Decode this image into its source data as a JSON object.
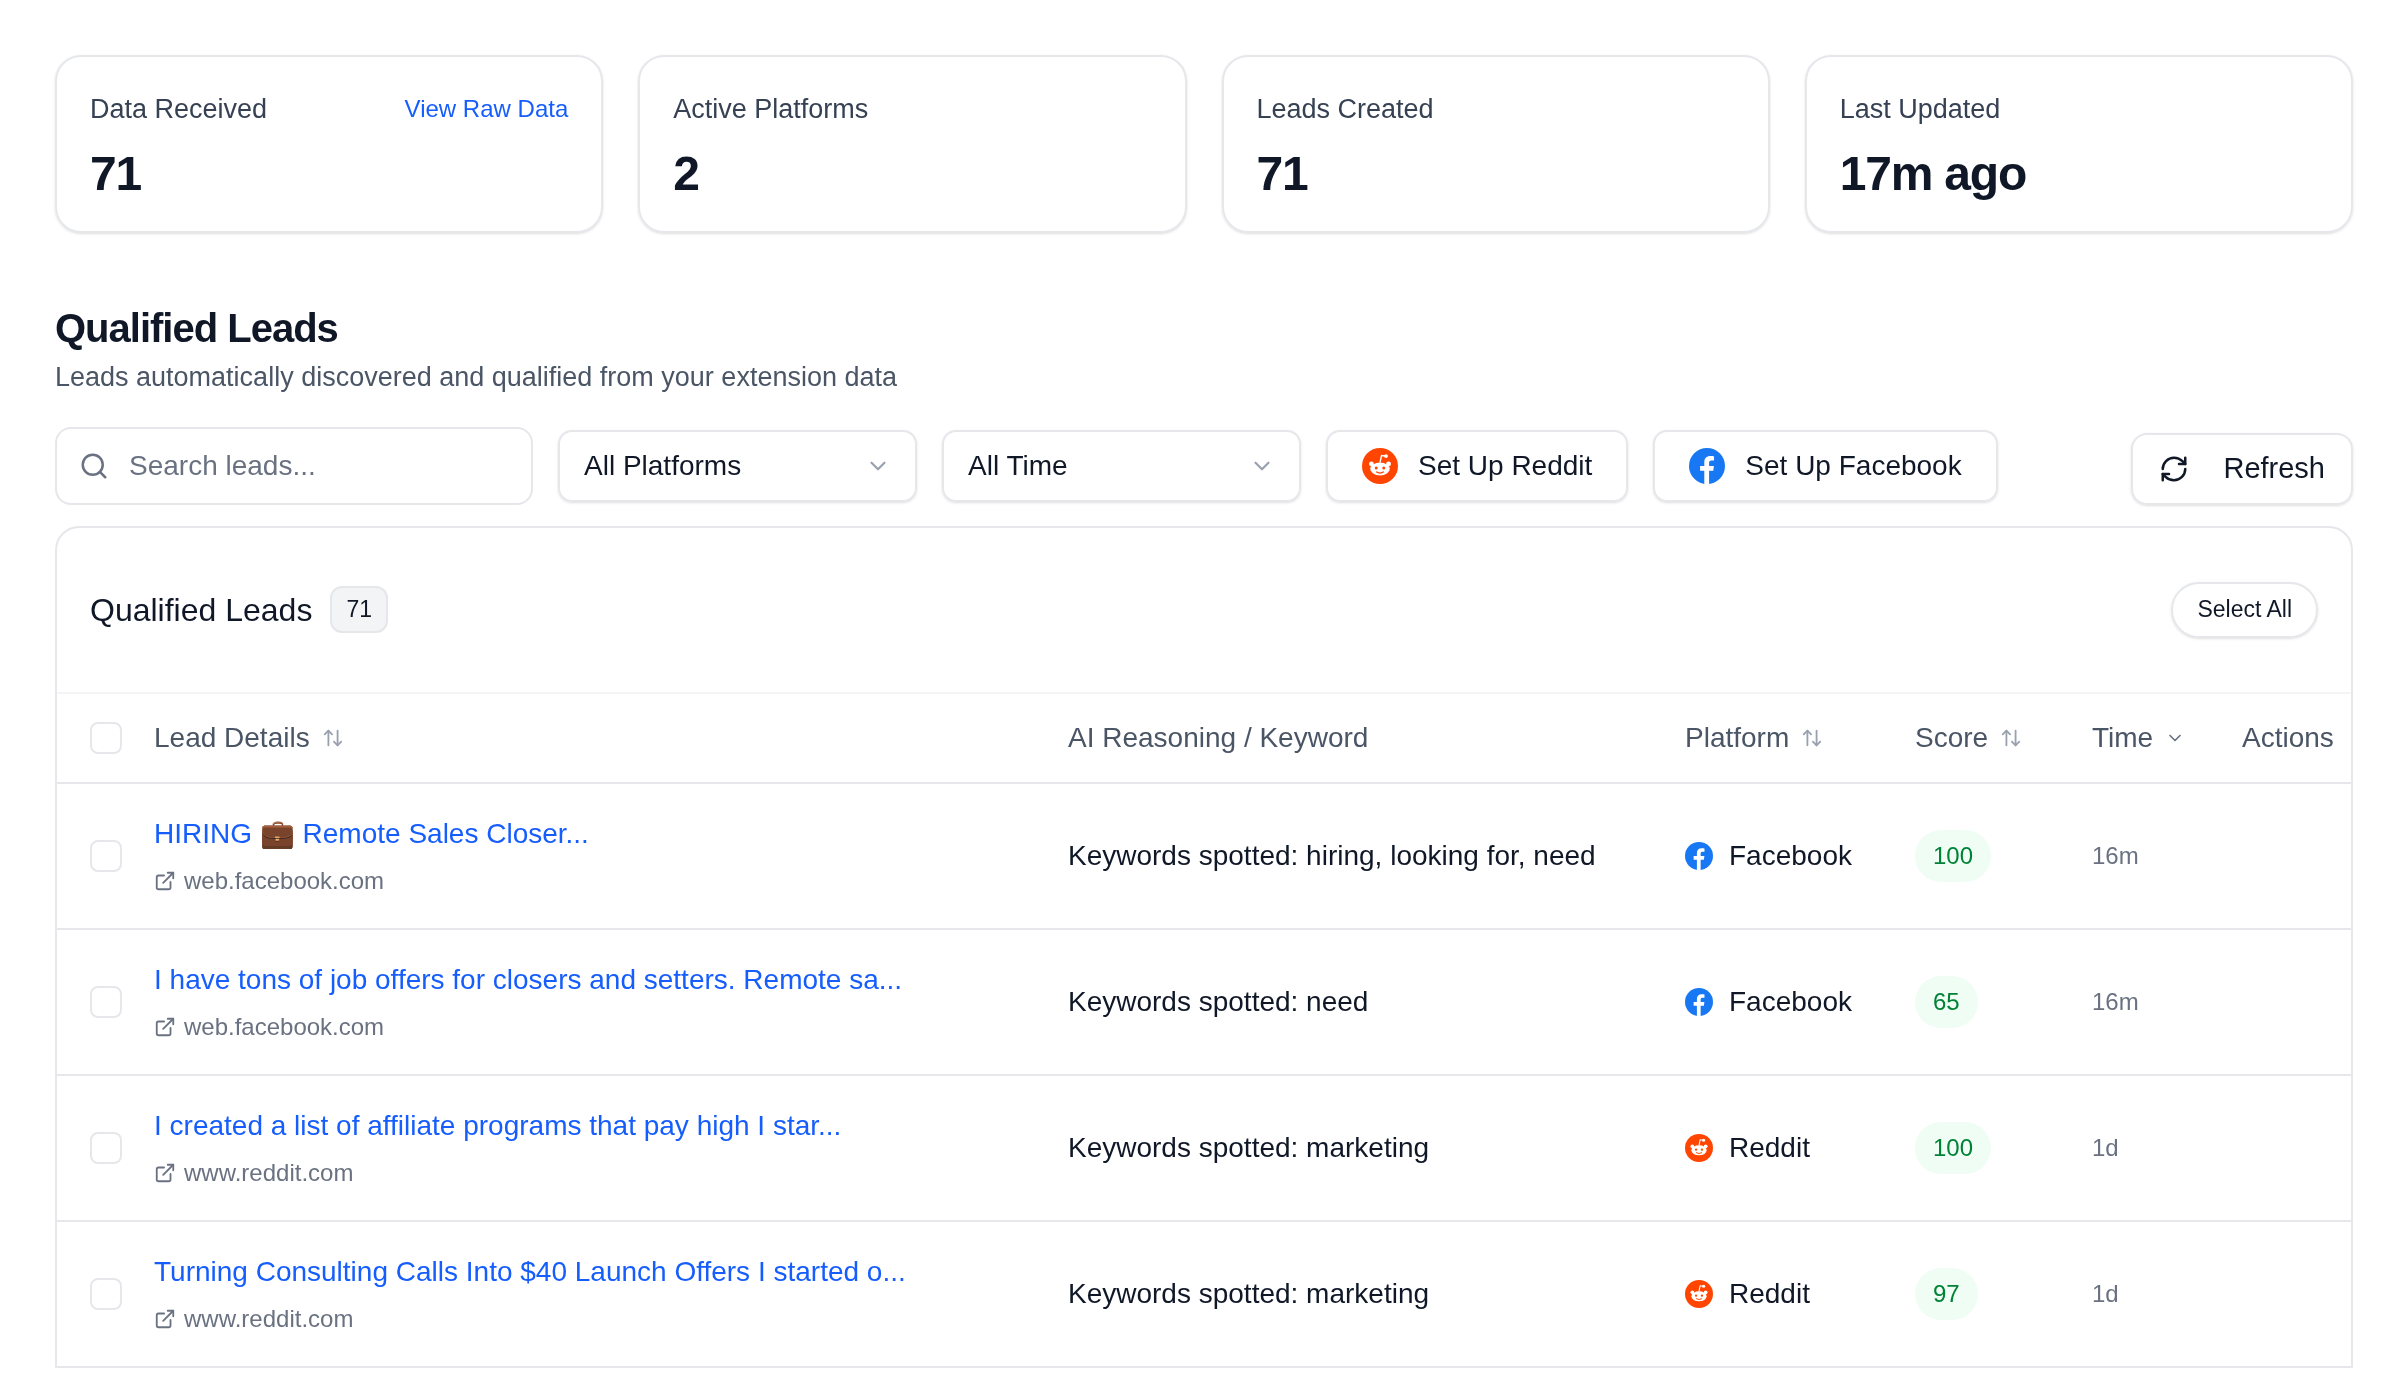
{
  "stats": [
    {
      "label": "Data Received",
      "value": "71",
      "link": "View Raw Data"
    },
    {
      "label": "Active Platforms",
      "value": "2"
    },
    {
      "label": "Leads Created",
      "value": "71"
    },
    {
      "label": "Last Updated",
      "value": "17m ago"
    }
  ],
  "section": {
    "title": "Qualified Leads",
    "subtitle": "Leads automatically discovered and qualified from your extension data"
  },
  "toolbar": {
    "search": {
      "placeholder": "Search leads..."
    },
    "platform_filter": "All Platforms",
    "time_filter": "All Time",
    "setup_buttons": [
      {
        "kind": "reddit",
        "label": "Set Up Reddit"
      },
      {
        "kind": "facebook",
        "label": "Set Up Facebook"
      }
    ],
    "refresh": "Refresh"
  },
  "table": {
    "title": "Qualified Leads",
    "count": "71",
    "select_all": "Select All",
    "all_checked": false,
    "columns": [
      {
        "label": "Lead Details",
        "kind": "sortable"
      },
      {
        "label": "AI Reasoning / Keyword",
        "kind": "plain"
      },
      {
        "label": "Platform",
        "kind": "sortable"
      },
      {
        "label": "Score",
        "kind": "sortable"
      },
      {
        "label": "Time",
        "kind": "sorted"
      },
      {
        "label": "Actions",
        "kind": "plain"
      }
    ],
    "rows": [
      {
        "checked": false,
        "title": "HIRING 💼 Remote Sales Closer...",
        "domain": "web.facebook.com",
        "reasoning": "Keywords spotted: hiring, looking for, need",
        "platform": {
          "kind": "facebook",
          "name": "Facebook"
        },
        "score": "100",
        "time": "16m"
      },
      {
        "checked": false,
        "title": "I have tons of job offers for closers and setters. Remote sa...",
        "domain": "web.facebook.com",
        "reasoning": "Keywords spotted: need",
        "platform": {
          "kind": "facebook",
          "name": "Facebook"
        },
        "score": "65",
        "time": "16m"
      },
      {
        "checked": false,
        "title": "I created a list of affiliate programs that pay high I star...",
        "domain": "www.reddit.com",
        "reasoning": "Keywords spotted: marketing",
        "platform": {
          "kind": "reddit",
          "name": "Reddit"
        },
        "score": "100",
        "time": "1d"
      },
      {
        "checked": false,
        "title": "Turning Consulting Calls Into $40 Launch Offers I started o...",
        "domain": "www.reddit.com",
        "reasoning": "Keywords spotted: marketing",
        "platform": {
          "kind": "reddit",
          "name": "Reddit"
        },
        "score": "97",
        "time": "1d"
      }
    ]
  }
}
